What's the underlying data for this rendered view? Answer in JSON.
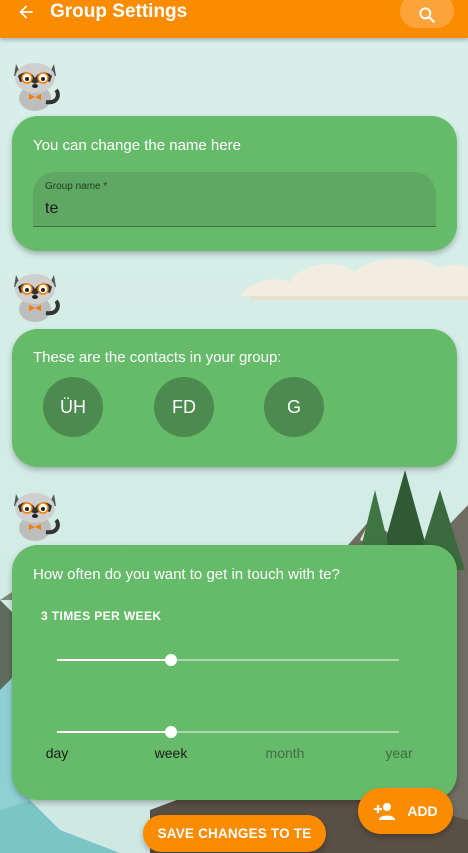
{
  "colors": {
    "appbar": "#fb8c00",
    "card": "#66bb6a",
    "avatar": "#4c8a4f",
    "button": "#fb8c00"
  },
  "appbar": {
    "title": "Group Settings",
    "back_icon": "arrow-back-icon",
    "search_icon": "search-icon"
  },
  "name_card": {
    "heading": "You can change the name here",
    "field_label": "Group name *",
    "field_value": "te"
  },
  "contacts_card": {
    "heading": "These are the contacts in your group:",
    "contacts": [
      {
        "initials": "ÜH"
      },
      {
        "initials": "FD"
      },
      {
        "initials": "G"
      }
    ]
  },
  "frequency_card": {
    "heading": "How often do you want to get in touch with te?",
    "frequency_label": "3 TIMES PER WEEK",
    "times_slider_fraction": 0.333,
    "period_slider_fraction": 0.333,
    "period_options": [
      "day",
      "week",
      "month",
      "year"
    ],
    "selected_period": "week"
  },
  "buttons": {
    "add_label": "ADD",
    "add_icon": "person-add-icon",
    "save_label": "SAVE CHANGES TO TE"
  }
}
